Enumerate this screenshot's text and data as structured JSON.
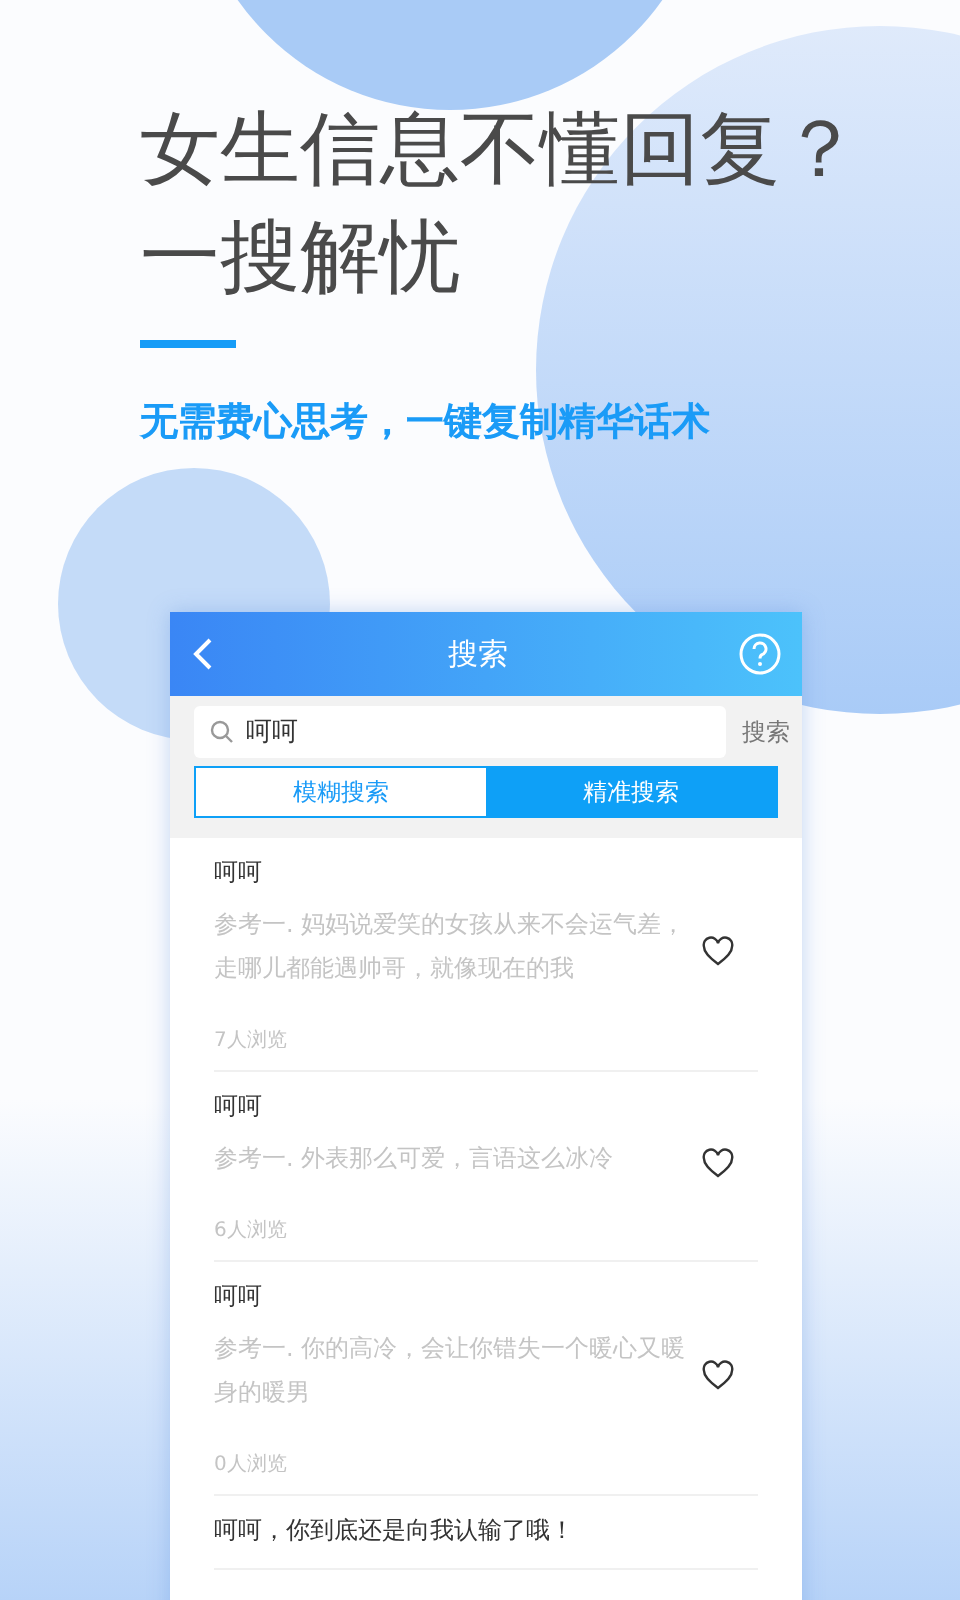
{
  "headline": [
    "女生信息不懂回复？",
    "一搜解忧"
  ],
  "subtitle": "无需费心思考，一键复制精华话术",
  "app": {
    "title": "搜索",
    "search": {
      "value": "呵呵",
      "button": "搜索"
    },
    "tabs": [
      {
        "label": "模糊搜索",
        "selected": false
      },
      {
        "label": "精准搜索",
        "selected": true
      }
    ],
    "results": [
      {
        "title": "呵呵",
        "text": "参考一. 妈妈说爱笑的女孩从来不会运气差，走哪儿都能遇帅哥，就像现在的我",
        "views": "7人浏览"
      },
      {
        "title": "呵呵",
        "text": "参考一. 外表那么可爱，言语这么冰冷",
        "views": "6人浏览"
      },
      {
        "title": "呵呵",
        "text": "参考一. 你的高冷，会让你错失一个暖心又暖身的暖男",
        "views": "0人浏览"
      },
      {
        "title": "呵呵，你到底还是向我认输了哦！"
      }
    ]
  }
}
